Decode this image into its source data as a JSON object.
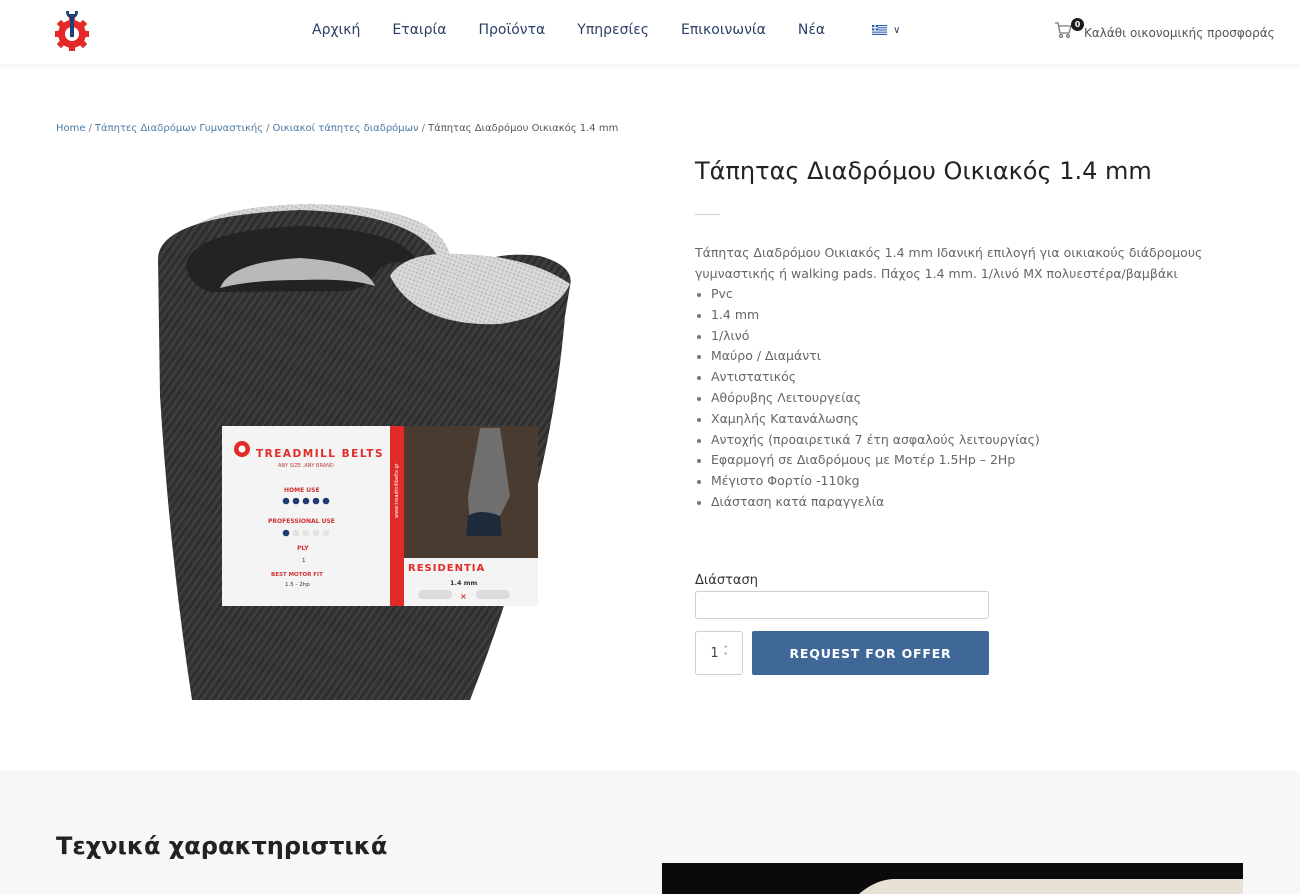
{
  "header": {
    "nav": [
      "Αρχική",
      "Εταιρία",
      "Προϊόντα",
      "Υπηρεσίες",
      "Επικοινωνία",
      "Νέα"
    ],
    "cart_count": "0",
    "cart_label": "Καλάθι οικονομικής προσφοράς"
  },
  "breadcrumb": {
    "items": [
      "Home",
      "Τάπητες Διαδρόμων Γυμναστικής",
      "Οικιακοί τάπητες διαδρόμων"
    ],
    "current": "Τάπητας Διαδρόμου Οικιακός 1.4 mm"
  },
  "product": {
    "title": "Τάπητας Διαδρόμου Οικιακός 1.4 mm",
    "description": "Τάπητας Διαδρόμου Οικιακός 1.4 mm Ιδανική επιλογή για οικιακούς διάδρομους γυμναστικής ή walking pads. Πάχος 1.4 mm. 1/λινό MX πολυεστέρα/βαμβάκι",
    "features": [
      "Pvc",
      "1.4 mm",
      "1/λινό",
      "Μαύρο / Διαμάντι",
      "Αντιστατικός",
      "Αθόρυβης Λειτουργείας",
      "Χαμηλής Κατανάλωσης",
      "Αντοχής (προαιρετικά 7 έτη ασφαλούς λειτουργίας)",
      "Εφαρμογή σε Διαδρόμους με Μοτέρ 1.5Hp – 2Hp",
      "Μέγιστο Φορτίο -110kg",
      "Διάσταση κατά παραγγελία"
    ],
    "dimension_label": "Διάσταση",
    "dimension_value": "",
    "quantity": "1",
    "offer_button": "REQUEST FOR OFFER"
  },
  "image_label": {
    "brand": "TREADMILL BELTS",
    "tagline": "ANY SIZE .ANY BRAND",
    "home_use": "HOME USE",
    "home_use_rating": 5,
    "professional_use": "PROFESSIONAL USE",
    "professional_use_rating": 1,
    "ply_label": "PLY",
    "ply_value": "1",
    "motor_label": "BEST MOTOR FIT",
    "motor_value": "1.5 - 2hp",
    "residential": "RESIDENTIA",
    "thickness": "1.4 mm",
    "website": "www.treadmillbelts.gr"
  },
  "section": {
    "tech_title": "Τεχνικά χαρακτηριστικά"
  },
  "colors": {
    "nav": "#2a3f66",
    "link": "#4a7aa5",
    "button": "#3f6898",
    "brand_red": "#e32a26"
  }
}
